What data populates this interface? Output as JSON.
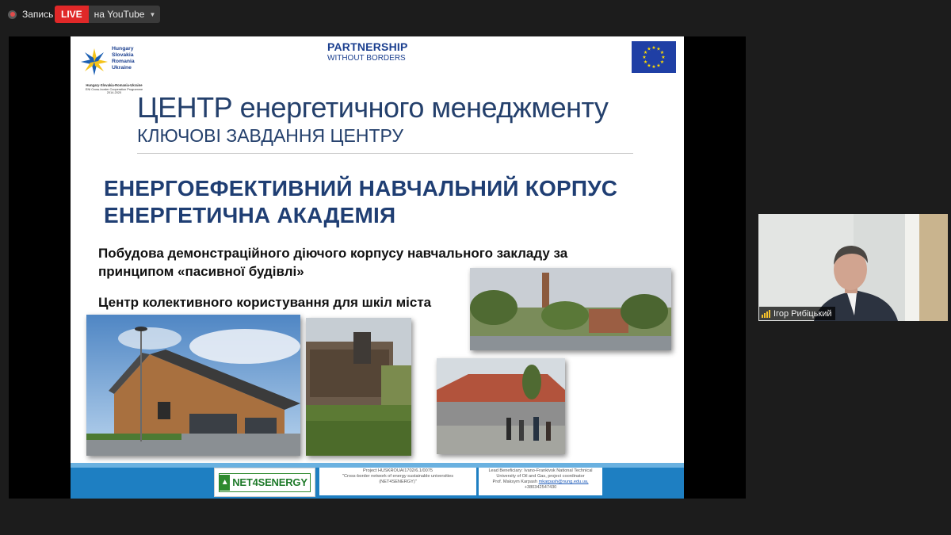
{
  "recording": {
    "label": "Запись"
  },
  "live": {
    "badge": "LIVE",
    "destination": "на YouTube"
  },
  "slide": {
    "logo": {
      "countries": [
        "Hungary",
        "Slovakia",
        "Romania",
        "Ukraine"
      ],
      "programme_line1": "Hungary-Slovakia-Romania-Ukraine",
      "programme_line2": "ENI Cross-border Cooperation Programme",
      "programme_line3": "2014-2020"
    },
    "partnership": {
      "line1": "PARTNERSHIP",
      "line2": "WITHOUT BORDERS"
    },
    "title": "ЦЕНТР енергетичного менеджменту",
    "subtitle": "КЛЮЧОВІ ЗАВДАННЯ ЦЕНТРУ",
    "heading1": "ЕНЕРГОЕФЕКТИВНИЙ НАВЧАЛЬНИЙ КОРПУС",
    "heading2": "ЕНЕРГЕТИЧНА АКАДЕМІЯ",
    "bullet1_line1": "Побудова демонстраційного діючого корпусу навчального закладу за",
    "bullet1_line2": "принципом «пасивної будівлі»",
    "bullet2": "Центр колективного користування для шкіл міста",
    "footer": {
      "net_logo": "NET4SENERGY",
      "project_line1": "Project HUSKROUA/1702/6.1/0075",
      "project_line2": "\"Cross-border network of energy sustainable universities",
      "project_line3": "(NET4SENERGY)\"",
      "lead_line1": "Lead Beneficiary: Ivano-Frankivsk National Technical",
      "lead_line2": "University of Oil and Gas, project coordinator",
      "lead_line3_prefix": "Prof. Maksym Karpash",
      "lead_email": "mkarpash@nung.edu.ua,",
      "lead_phone": "+380342547430"
    }
  },
  "participant": {
    "name": "Ігор Рибіцький"
  },
  "colors": {
    "live_red": "#e02828",
    "slide_title": "#24406c",
    "footer_blue": "#1e7fc2",
    "net_green": "#2f8a2f",
    "eu_blue": "#1f3fa5",
    "eu_star": "#ffdd00"
  }
}
